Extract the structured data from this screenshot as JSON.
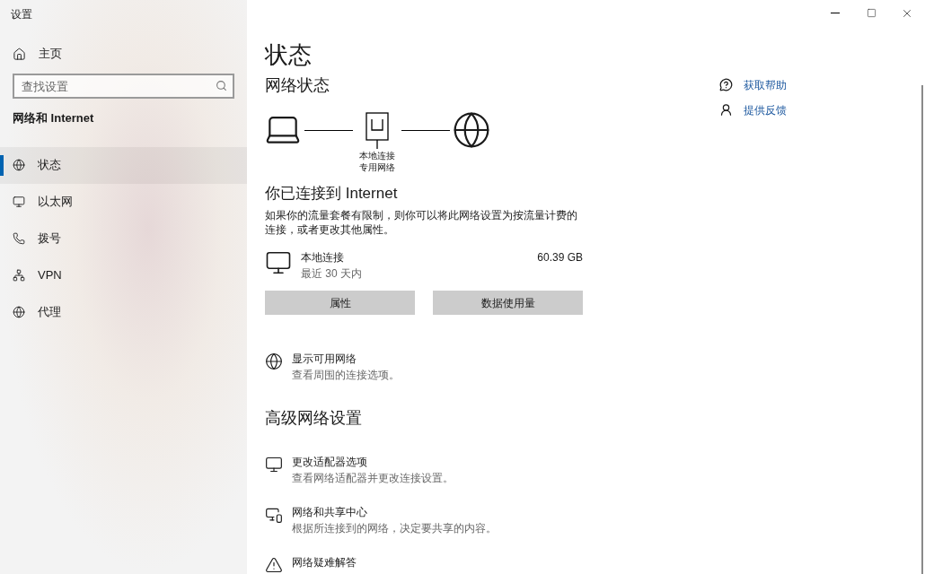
{
  "window": {
    "title": "设置"
  },
  "sidebar": {
    "home": "主页",
    "search": {
      "placeholder": "查找设置"
    },
    "section": "网络和 Internet",
    "items": [
      {
        "label": "状态",
        "selected": true
      },
      {
        "label": "以太网",
        "selected": false
      },
      {
        "label": "拨号",
        "selected": false
      },
      {
        "label": "VPN",
        "selected": false
      },
      {
        "label": "代理",
        "selected": false
      }
    ]
  },
  "page": {
    "title": "状态",
    "network_status": {
      "heading": "网络状态",
      "node_label": [
        "本地连接",
        "专用网络"
      ]
    },
    "connected": {
      "heading": "你已连接到 Internet",
      "text": "如果你的流量套餐有限制，则你可以将此网络设置为按流量计费的连接，或者更改其他属性。"
    },
    "connection": {
      "name": "本地连接",
      "period": "最近 30 天内",
      "usage": "60.39 GB"
    },
    "buttons": [
      "属性",
      "数据使用量"
    ],
    "show_networks": {
      "title": "显示可用网络",
      "subtitle": "查看周围的连接选项。"
    },
    "advanced": {
      "heading": "高级网络设置",
      "items": [
        {
          "title": "更改适配器选项",
          "subtitle": "查看网络适配器并更改连接设置。"
        },
        {
          "title": "网络和共享中心",
          "subtitle": "根据所连接到的网络，决定要共享的内容。"
        },
        {
          "title": "网络疑难解答"
        }
      ]
    }
  },
  "help_links": [
    {
      "label": "获取帮助"
    },
    {
      "label": "提供反馈"
    }
  ]
}
